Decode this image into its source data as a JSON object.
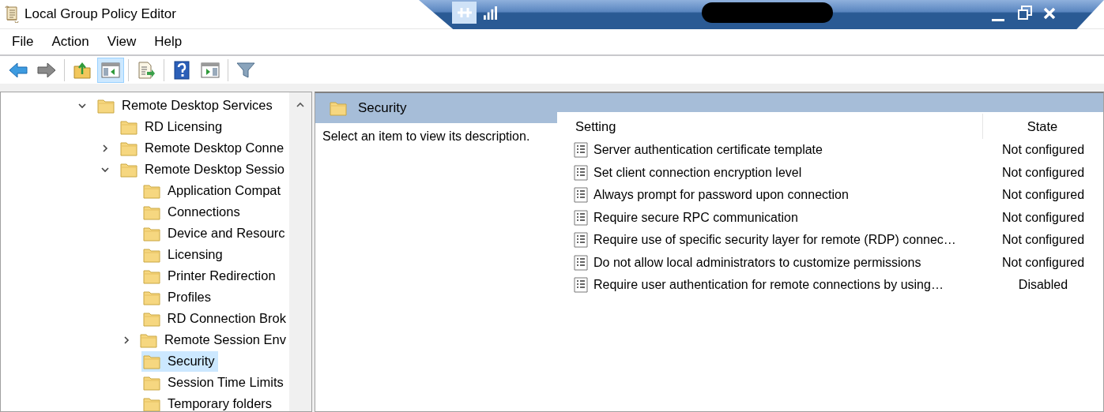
{
  "window": {
    "title": "Local Group Policy Editor"
  },
  "menu": [
    "File",
    "Action",
    "View",
    "Help"
  ],
  "toolbar": [
    {
      "selected": false
    },
    {
      "selected": false
    },
    {
      "selected": false
    },
    {
      "selected": true
    },
    {
      "selected": false
    },
    {
      "selected": false
    },
    {
      "selected": false
    },
    {
      "selected": false
    }
  ],
  "tree": [
    {
      "label": "Remote Desktop Services",
      "expanded": true,
      "selected": false,
      "children": [
        {
          "label": "RD Licensing",
          "selected": false
        },
        {
          "label": "Remote Desktop Conne",
          "expanded": false,
          "selected": false
        },
        {
          "label": "Remote Desktop Sessio",
          "expanded": true,
          "selected": false,
          "children": [
            {
              "label": "Application Compat",
              "selected": false
            },
            {
              "label": "Connections",
              "selected": false
            },
            {
              "label": "Device and Resourc",
              "selected": false
            },
            {
              "label": "Licensing",
              "selected": false
            },
            {
              "label": "Printer Redirection",
              "selected": false
            },
            {
              "label": "Profiles",
              "selected": false
            },
            {
              "label": "RD Connection Brok",
              "selected": false
            },
            {
              "label": "Remote Session Env",
              "expanded": false,
              "selected": false
            },
            {
              "label": "Security",
              "selected": true
            },
            {
              "label": "Session Time Limits",
              "selected": false
            },
            {
              "label": "Temporary folders",
              "selected": false
            }
          ]
        }
      ]
    }
  ],
  "details": {
    "title": "Security",
    "description": "Select an item to view its description.",
    "columns": [
      "Setting",
      "State"
    ],
    "rows": [
      {
        "setting": "Server authentication certificate template",
        "state": "Not configured"
      },
      {
        "setting": "Set client connection encryption level",
        "state": "Not configured"
      },
      {
        "setting": "Always prompt for password upon connection",
        "state": "Not configured"
      },
      {
        "setting": "Require secure RPC communication",
        "state": "Not configured"
      },
      {
        "setting": "Require use of specific security layer for remote (RDP) connec…",
        "state": "Not configured"
      },
      {
        "setting": "Do not allow local administrators to customize permissions",
        "state": "Not configured"
      },
      {
        "setting": "Require user authentication for remote connections by using…",
        "state": "Disabled"
      }
    ]
  }
}
